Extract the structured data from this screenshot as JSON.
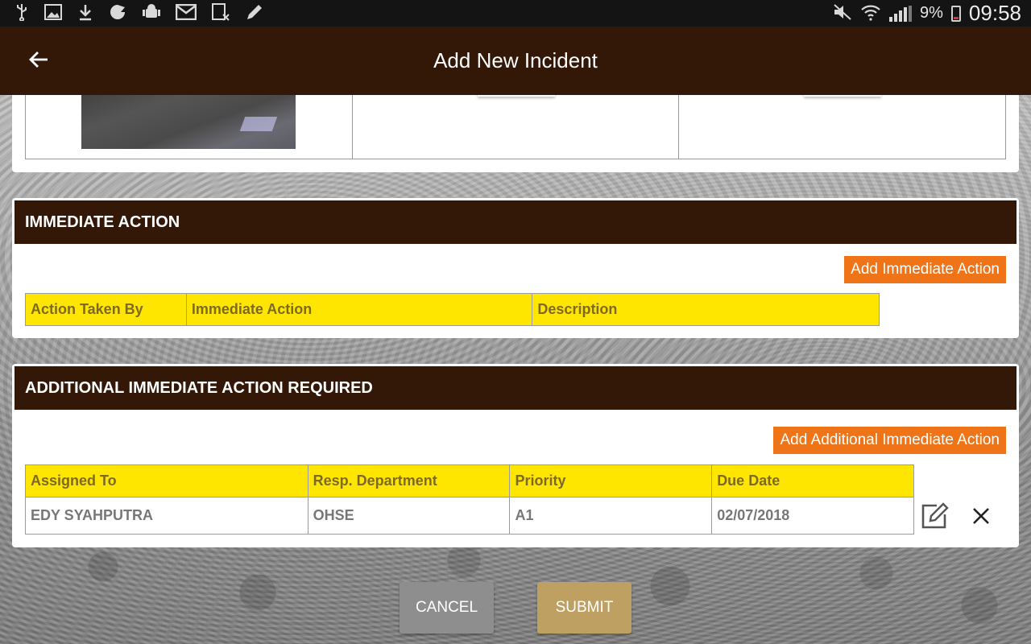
{
  "status_bar": {
    "battery_percent": "9%",
    "time": "09:58",
    "left_icons": [
      "usb-icon",
      "image-icon",
      "download-icon",
      "sync-icon",
      "android-icon",
      "gmail-icon",
      "file-cancel-icon",
      "pencil-icon"
    ],
    "right_icons": [
      "mute-icon",
      "wifi-icon",
      "signal-icon",
      "battery-icon"
    ]
  },
  "app_bar": {
    "title": "Add New Incident",
    "back_icon": "arrow-left-icon"
  },
  "immediate_action": {
    "title": "IMMEDIATE ACTION",
    "add_button": "Add Immediate Action",
    "columns": [
      "Action Taken By",
      "Immediate Action",
      "Description"
    ]
  },
  "additional_action": {
    "title": "ADDITIONAL IMMEDIATE ACTION REQUIRED",
    "add_button": "Add Additional Immediate Action",
    "columns": [
      "Assigned To",
      "Resp. Department",
      "Priority",
      "Due Date"
    ],
    "rows": [
      {
        "assigned_to": "EDY SYAHPUTRA",
        "department": "OHSE",
        "priority": "A1",
        "due_date": "02/07/2018"
      }
    ]
  },
  "footer": {
    "cancel": "CANCEL",
    "submit": "SUBMIT"
  },
  "colors": {
    "header_brown": "#331808",
    "accent_orange": "#ef7417",
    "table_header_yellow": "#ffe600",
    "submit_tan": "#bfa063",
    "cancel_gray": "#8e8e8e"
  }
}
